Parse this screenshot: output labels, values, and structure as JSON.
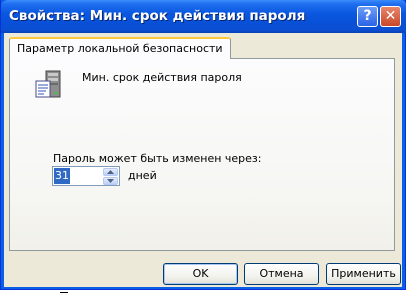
{
  "window": {
    "title": "Свойства: Мин. срок действия пароля",
    "help_symbol": "?",
    "close_symbol": "✕"
  },
  "tabs": [
    {
      "label": "Параметр локальной безопасности",
      "selected": true
    }
  ],
  "policy": {
    "icon": "server-policy-icon",
    "name": "Мин. срок действия пароля"
  },
  "setting": {
    "label": "Пароль может быть изменен через:",
    "value": "31",
    "unit": "дней"
  },
  "buttons": {
    "ok": "OK",
    "cancel": "Отмена",
    "apply": "Применить"
  },
  "colors": {
    "title_bar": "#0a58e0",
    "dialog_face": "#ece9d8",
    "selected_text_bg": "#316ac5",
    "tab_highlight": "#ffc83c"
  }
}
